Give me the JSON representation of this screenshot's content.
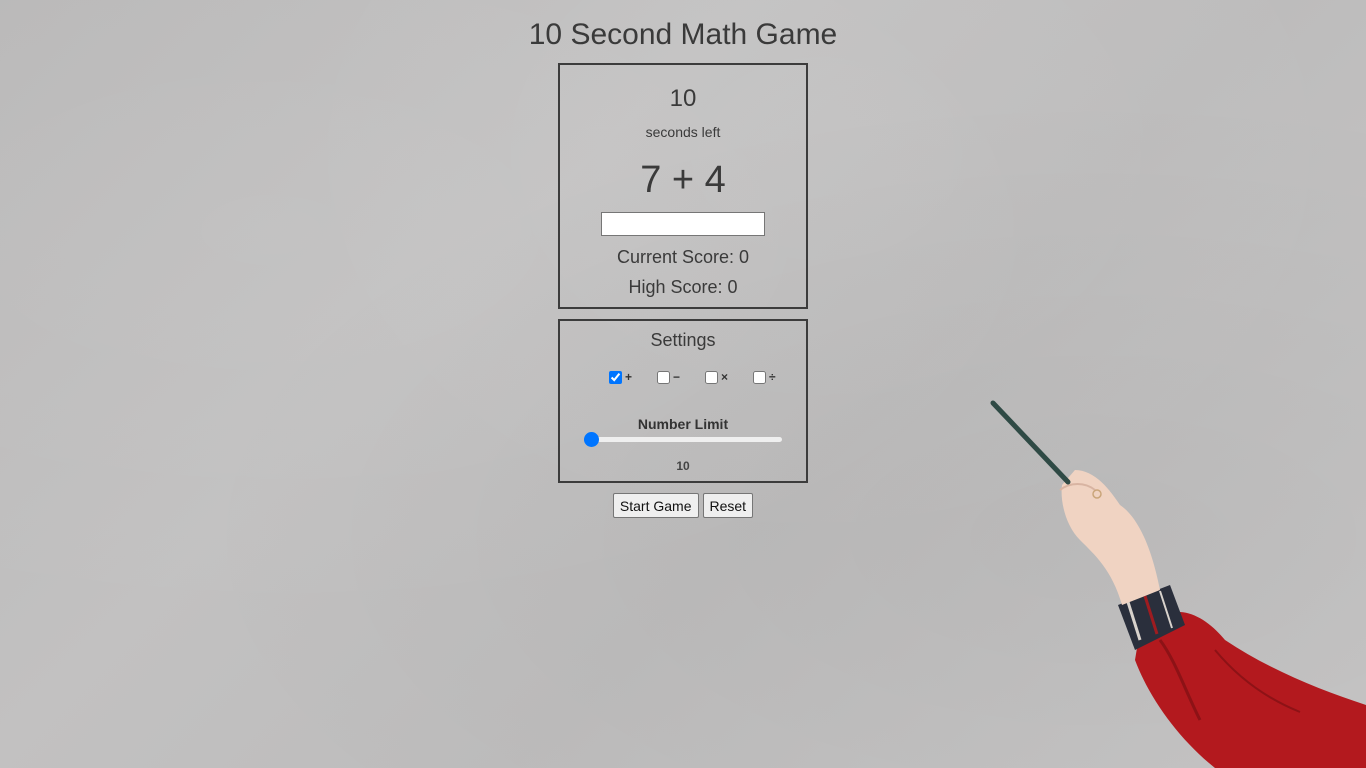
{
  "title": "10 Second Math Game",
  "game": {
    "seconds_left_value": "10",
    "seconds_left_label": "seconds left",
    "problem": "7 + 4",
    "answer_value": "",
    "current_score": "Current Score: 0",
    "high_score": "High Score: 0"
  },
  "settings": {
    "title": "Settings",
    "operators": [
      {
        "symbol": "+",
        "checked": true
      },
      {
        "symbol": "−",
        "checked": false
      },
      {
        "symbol": "×",
        "checked": false
      },
      {
        "symbol": "÷",
        "checked": false
      }
    ],
    "number_limit_label": "Number Limit",
    "number_limit_value": "10",
    "number_limit_slider_fraction": 0.0
  },
  "controls": {
    "start_label": "Start Game",
    "reset_label": "Reset"
  },
  "colors": {
    "accent": "#0075ff",
    "border": "#3c3c3c",
    "text": "#3a3a3a"
  }
}
